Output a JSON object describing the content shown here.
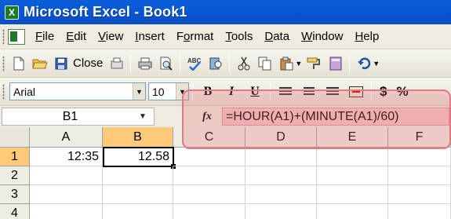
{
  "window": {
    "title": "Microsoft Excel - Book1",
    "app_icon_glyph": "X"
  },
  "menu": [
    "File",
    "Edit",
    "View",
    "Insert",
    "Format",
    "Tools",
    "Data",
    "Window",
    "Help"
  ],
  "menu_underline": [
    "F",
    "E",
    "V",
    "I",
    "o",
    "T",
    "D",
    "W",
    "H"
  ],
  "toolbar": {
    "close_label": "Close",
    "icons": [
      "new-icon",
      "open-icon",
      "save-icon",
      "permission-icon",
      "print-icon",
      "print-preview-icon",
      "spelling-icon",
      "research-icon",
      "cut-icon",
      "copy-icon",
      "paste-icon",
      "format-painter-icon",
      "calculator-icon",
      "undo-icon"
    ]
  },
  "formatting": {
    "font": "Arial",
    "size": "10",
    "bold": "B",
    "italic": "I",
    "underline": "U",
    "currency": "$",
    "percent": "%"
  },
  "formula_bar": {
    "name_box": "B1",
    "fx": "fx",
    "formula": "=HOUR(A1)+(MINUTE(A1)/60)"
  },
  "sheet": {
    "columns": [
      "A",
      "B",
      "C",
      "D",
      "E",
      "F"
    ],
    "rows": [
      "1",
      "2",
      "3",
      "4"
    ],
    "cells": {
      "A1": "12:35",
      "B1": "12.58"
    },
    "active_cell": "B1"
  },
  "colors": {
    "title_bar": "#0757d6",
    "highlight": "#e86e78",
    "active_header": "#ffc97a"
  }
}
